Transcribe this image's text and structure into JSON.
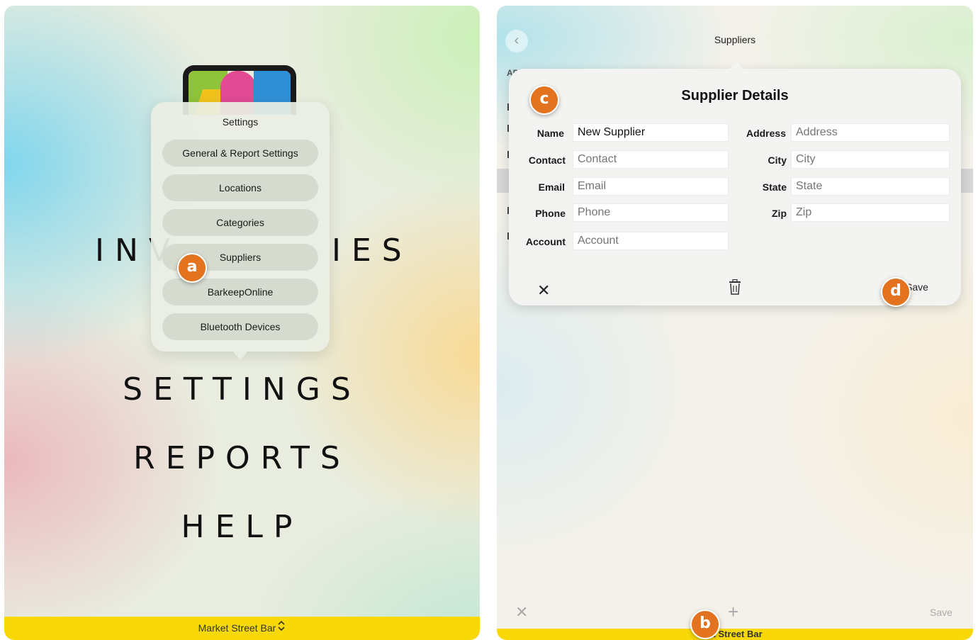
{
  "left": {
    "menu_words": {
      "inventories_left": "INV",
      "inventories_right": "IES",
      "settings": "SETTINGS",
      "reports": "REPORTS",
      "help": "HELP"
    },
    "popover": {
      "title": "Settings",
      "items": [
        {
          "label": "General & Report Settings"
        },
        {
          "label": "Locations"
        },
        {
          "label": "Categories"
        },
        {
          "label": "Suppliers"
        },
        {
          "label": "BarkeepOnline"
        },
        {
          "label": "Bluetooth Devices"
        }
      ]
    },
    "bottom_bar": {
      "location": "Market Street Bar",
      "chevron": "⌃⌄"
    },
    "marker_a": "a"
  },
  "right": {
    "nav": {
      "back_icon": "‹",
      "title": "Suppliers"
    },
    "list_label": "AP",
    "detail": {
      "title": "Supplier Details",
      "fields_left": [
        {
          "label": "Name",
          "value": "New Supplier",
          "placeholder": ""
        },
        {
          "label": "Contact",
          "value": "",
          "placeholder": "Contact"
        },
        {
          "label": "Email",
          "value": "",
          "placeholder": "Email"
        },
        {
          "label": "Phone",
          "value": "",
          "placeholder": "Phone"
        },
        {
          "label": "Account",
          "value": "",
          "placeholder": "Account"
        }
      ],
      "fields_right": [
        {
          "label": "Address",
          "value": "",
          "placeholder": "Address"
        },
        {
          "label": "City",
          "value": "",
          "placeholder": "City"
        },
        {
          "label": "State",
          "value": "",
          "placeholder": "State"
        },
        {
          "label": "Zip",
          "value": "",
          "placeholder": "Zip"
        }
      ],
      "close_icon": "✕",
      "save_label": "Save"
    },
    "bottom_toolbar": {
      "close_icon": "✕",
      "add_icon": "+",
      "save_label": "Save"
    },
    "bottom_bar": {
      "location_partial": "et Street Bar"
    },
    "marker_b": "b",
    "marker_c": "c",
    "marker_d": "d"
  },
  "colors": {
    "accent_yellow": "#f8d807",
    "marker_orange": "#e4731f"
  }
}
